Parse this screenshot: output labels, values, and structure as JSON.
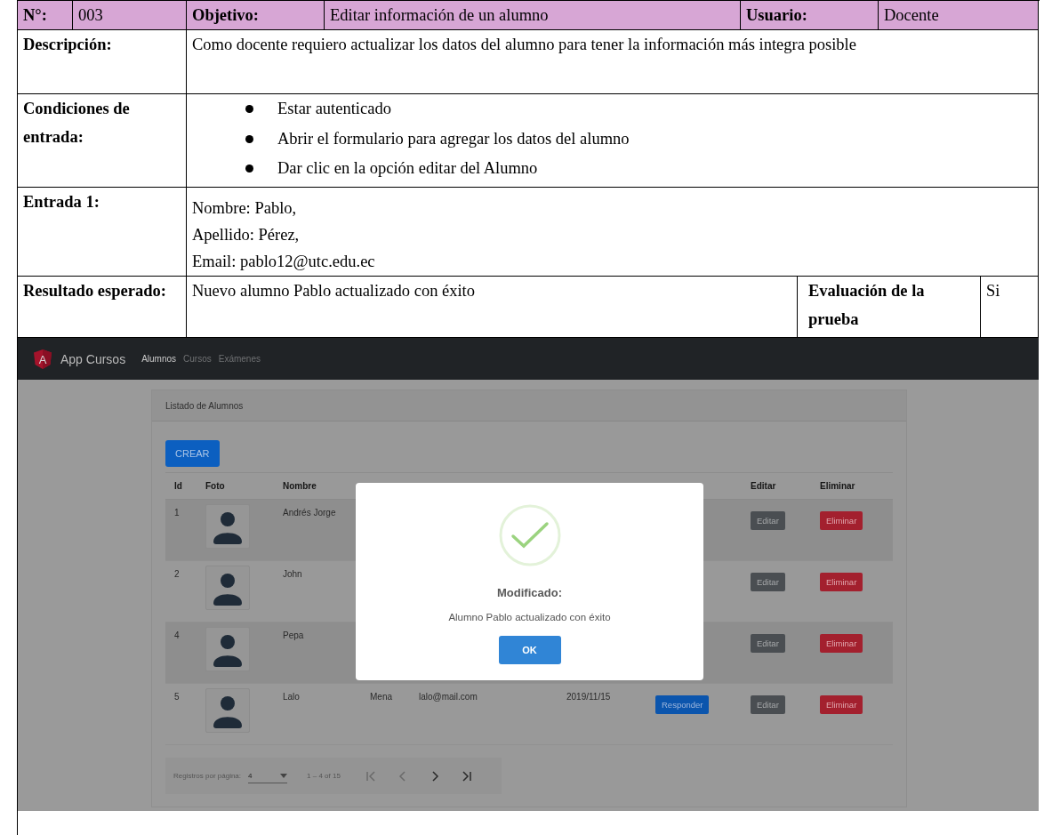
{
  "case": {
    "number_label": "N°:",
    "number": "003",
    "objective_label": "Objetivo:",
    "objective": "Editar información de un alumno",
    "user_label": "Usuario:",
    "user": "Docente"
  },
  "rows": [
    {
      "kind": "text",
      "label": "Descripción:",
      "text": "Como docente requiero actualizar los datos del alumno para tener la información más integra posible"
    },
    {
      "kind": "bullets",
      "label": "Condiciones de entrada:",
      "items": [
        "Estar autenticado",
        "Abrir el formulario para agregar los datos del alumno",
        "Dar clic en la opción editar del Alumno"
      ]
    },
    {
      "kind": "lines",
      "label": "Entrada 1:",
      "items": [
        "Nombre: Pablo,",
        "Apellido: Pérez,",
        "Email: pablo12@utc.edu.ec"
      ]
    },
    {
      "kind": "result",
      "label": "Resultado esperado:",
      "text": "Nuevo alumno Pablo actualizado con éxito",
      "eval_label": "Evaluación de la prueba",
      "eval": "Si"
    }
  ],
  "app": {
    "logo_letter": "A",
    "brand": "App Cursos",
    "nav": [
      {
        "label": "Alumnos",
        "selected": true
      },
      {
        "label": "Cursos",
        "selected": false
      },
      {
        "label": "Exámenes",
        "selected": false
      }
    ],
    "card_title": "Listado de Alumnos",
    "create_button": "CREAR",
    "columns": [
      "Id",
      "Foto",
      "Nombre",
      "Editar",
      "Eliminar"
    ],
    "students": [
      {
        "id": "1",
        "name": "Andrés Jorge",
        "edit": "Editar",
        "delete": "Eliminar"
      },
      {
        "id": "2",
        "name": "John",
        "edit": "Editar",
        "delete": "Eliminar"
      },
      {
        "id": "4",
        "name": "Pepa",
        "edit": "Editar",
        "delete": "Eliminar"
      },
      {
        "id": "5",
        "name": "Lalo",
        "surname": "Mena",
        "email": "lalo@mail.com",
        "date": "2019/11/15",
        "respond": "Responder",
        "edit": "Editar",
        "delete": "Eliminar"
      }
    ],
    "paginator": {
      "label": "Registros por página:",
      "page_size": "4",
      "range": "1 – 4 of 15"
    },
    "modal": {
      "title": "Modificado:",
      "message": "Alumno Pablo actualizado con éxito",
      "button": "OK"
    }
  }
}
